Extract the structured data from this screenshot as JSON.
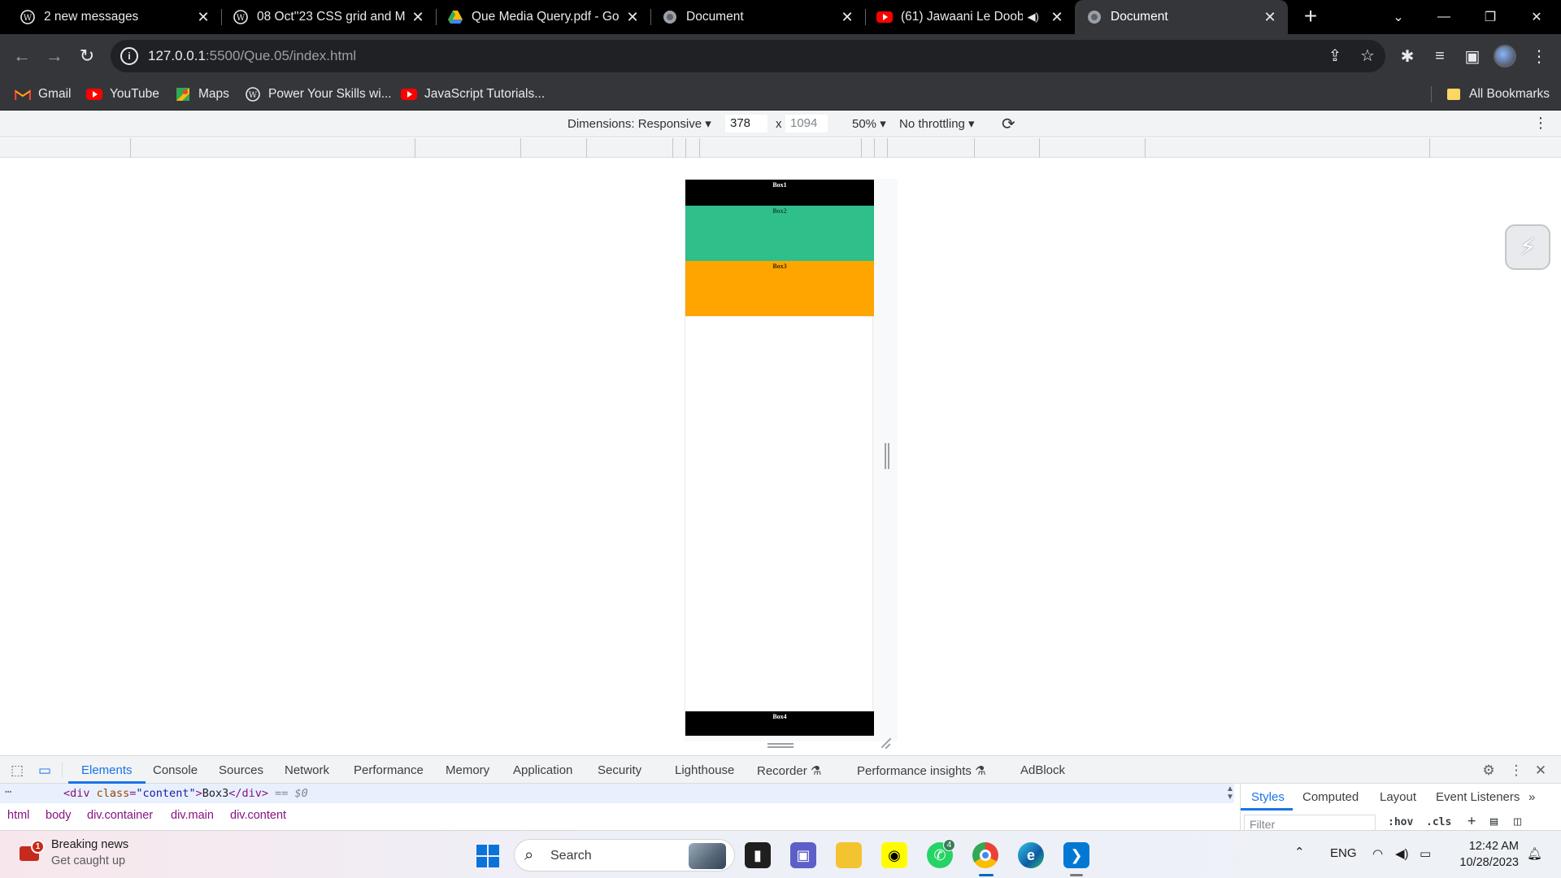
{
  "tabs": [
    {
      "title": "2 new messages",
      "icon": "wordpress-icon"
    },
    {
      "title": "08 Oct''23 CSS grid and Me",
      "icon": "wordpress-icon"
    },
    {
      "title": "Que Media Query.pdf - Go",
      "icon": "google-drive-icon"
    },
    {
      "title": "Document",
      "icon": "globe-icon"
    },
    {
      "title": "(61) Jawaani Le Doobi",
      "icon": "youtube-icon"
    },
    {
      "title": "Document",
      "icon": "globe-icon",
      "active": true
    }
  ],
  "address": {
    "host": "127.0.0.1",
    "path": ":5500/Que.05/index.html"
  },
  "bookmarks": [
    {
      "label": "Gmail",
      "icon": "gmail-icon"
    },
    {
      "label": "YouTube",
      "icon": "youtube-icon"
    },
    {
      "label": "Maps",
      "icon": "maps-icon"
    },
    {
      "label": "Power Your Skills wi...",
      "icon": "wordpress-icon"
    },
    {
      "label": "JavaScript Tutorials...",
      "icon": "youtube-icon"
    },
    {
      "label": "All Bookmarks",
      "icon": "folder-icon"
    }
  ],
  "device_toolbar": {
    "dimensions_label": "Dimensions: Responsive",
    "width": "378",
    "times": "x",
    "height": "1094",
    "zoom": "50%",
    "throttling": "No throttling"
  },
  "page": {
    "boxes": [
      "Box1",
      "Box2",
      "Box3",
      "Box4"
    ],
    "colors": {
      "box1": "#000000",
      "box2": "#2ebf8a",
      "box3": "#ffa500",
      "box4": "#000000"
    }
  },
  "devtools": {
    "tabs": [
      "Elements",
      "Console",
      "Sources",
      "Network",
      "Performance",
      "Memory",
      "Application",
      "Security",
      "Lighthouse",
      "Recorder",
      "Performance insights",
      "AdBlock"
    ],
    "selected_node": {
      "open": "<div ",
      "attr": "class",
      "eq": "=",
      "value": "\"content\"",
      "close": ">",
      "text": "Box3",
      "end": "</div>",
      "ref": " == $0"
    },
    "breadcrumbs": [
      "html",
      "body",
      "div.container",
      "div.main",
      "div.content"
    ],
    "side_tabs": [
      "Styles",
      "Computed",
      "Layout",
      "Event Listeners"
    ],
    "filter_placeholder": "Filter",
    "hov": ":hov",
    "cls": ".cls"
  },
  "taskbar": {
    "news_title": "Breaking news",
    "news_subtitle": "Get caught up",
    "news_badge": "1",
    "search_label": "Search",
    "whatsapp_badge": "4",
    "language": "ENG",
    "time": "12:42 AM",
    "date": "10/28/2023"
  }
}
